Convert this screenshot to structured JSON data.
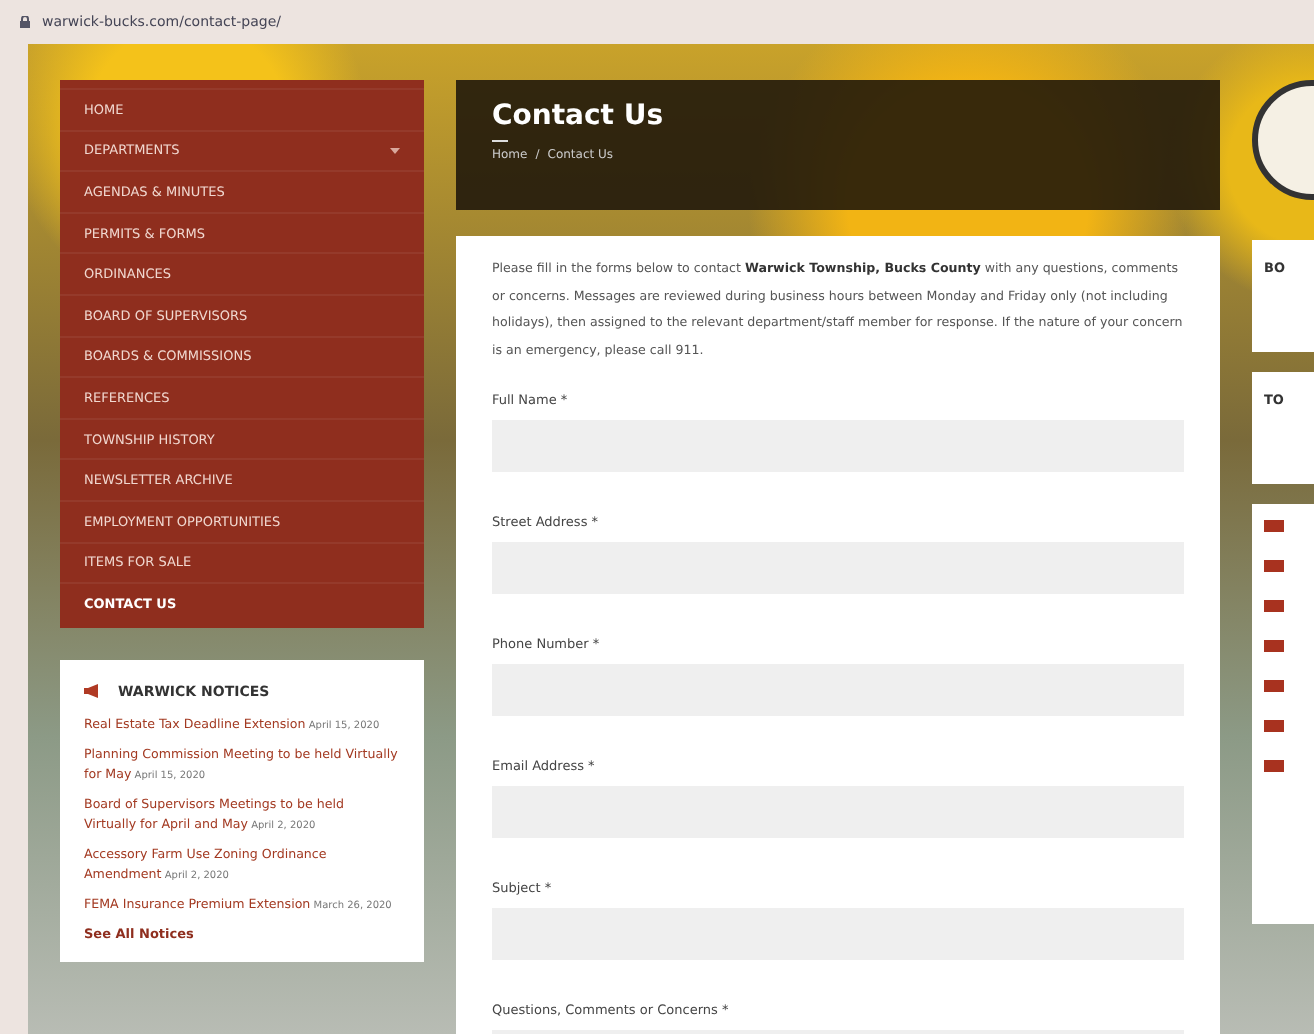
{
  "browser": {
    "url": "warwick-bucks.com/contact-page/"
  },
  "nav": {
    "items": [
      {
        "label": "HOME",
        "selected": false,
        "has_submenu": false
      },
      {
        "label": "DEPARTMENTS",
        "selected": false,
        "has_submenu": true
      },
      {
        "label": "AGENDAS & MINUTES",
        "selected": false,
        "has_submenu": false
      },
      {
        "label": "PERMITS & FORMS",
        "selected": false,
        "has_submenu": false
      },
      {
        "label": "ORDINANCES",
        "selected": false,
        "has_submenu": false
      },
      {
        "label": "BOARD OF SUPERVISORS",
        "selected": false,
        "has_submenu": false
      },
      {
        "label": "BOARDS & COMMISSIONS",
        "selected": false,
        "has_submenu": false
      },
      {
        "label": "REFERENCES",
        "selected": false,
        "has_submenu": false
      },
      {
        "label": "TOWNSHIP HISTORY",
        "selected": false,
        "has_submenu": false
      },
      {
        "label": "NEWSLETTER ARCHIVE",
        "selected": false,
        "has_submenu": false
      },
      {
        "label": "EMPLOYMENT OPPORTUNITIES",
        "selected": false,
        "has_submenu": false
      },
      {
        "label": "ITEMS FOR SALE",
        "selected": false,
        "has_submenu": false
      },
      {
        "label": "CONTACT US",
        "selected": true,
        "has_submenu": false
      }
    ]
  },
  "notices": {
    "title": "WARWICK NOTICES",
    "items": [
      {
        "title": "Real Estate Tax Deadline Extension",
        "date": "April 15, 2020"
      },
      {
        "title": "Planning Commission Meeting to be held Virtually for May",
        "date": "April 15, 2020"
      },
      {
        "title": "Board of Supervisors Meetings to be held Virtually for April and May",
        "date": "April 2, 2020"
      },
      {
        "title": "Accessory Farm Use Zoning Ordinance Amendment",
        "date": "April 2, 2020"
      },
      {
        "title": "FEMA Insurance Premium Extension",
        "date": "March 26, 2020"
      }
    ],
    "link": "See All Notices"
  },
  "page_header": {
    "title": "Contact Us",
    "breadcrumb": [
      "Home",
      "Contact Us"
    ],
    "separator": "/"
  },
  "form": {
    "intro": "Please fill in the forms below to contact **Warwick Township, Bucks County** with any questions, comments or concerns.  Messages are reviewed during business hours between Monday and Friday only (not including holidays), then assigned to the relevant department/staff member for response.  If the nature of your concern is an emergency, please call 911.",
    "fields": [
      {
        "label": "Full Name *"
      },
      {
        "label": "Street Address *"
      },
      {
        "label": "Phone Number *"
      },
      {
        "label": "Email Address *"
      },
      {
        "label": "Subject *"
      },
      {
        "label": "Questions, Comments or Concerns *"
      }
    ]
  },
  "right_rail": {
    "cards": [
      {
        "kind": "text",
        "heading": "BO"
      },
      {
        "kind": "text",
        "heading": "TO"
      },
      {
        "kind": "list"
      }
    ]
  }
}
